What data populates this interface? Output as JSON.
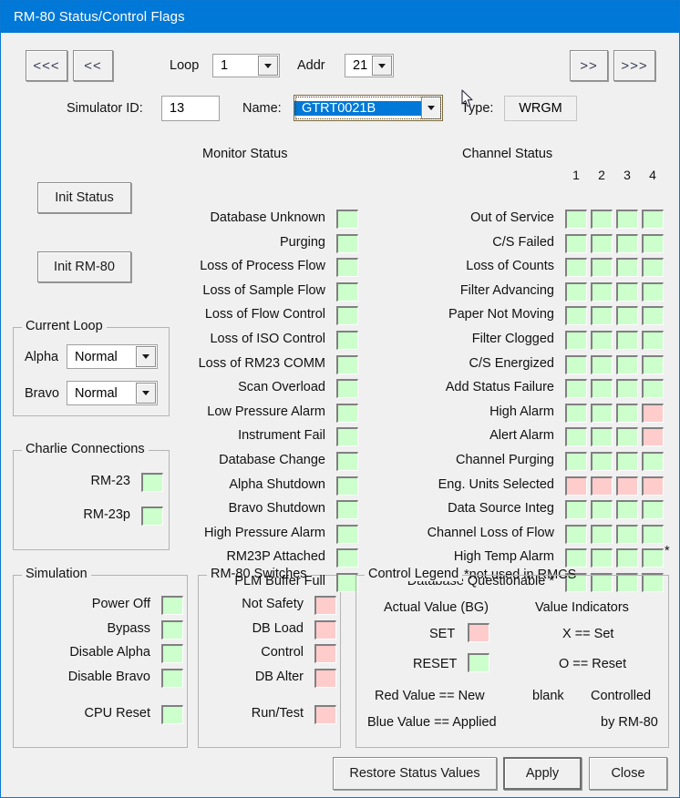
{
  "window": {
    "title": "RM-80 Status/Control Flags"
  },
  "toolbar": {
    "first_label": "<<<",
    "prev_label": "<<",
    "next_label": ">>",
    "last_label": ">>>",
    "loop_label": "Loop",
    "loop_value": "1",
    "addr_label": "Addr",
    "addr_value": "21"
  },
  "identity": {
    "simulator_id_label": "Simulator ID:",
    "simulator_id_value": "13",
    "name_label": "Name:",
    "name_value": "GTRT0021B",
    "type_label": "Type:",
    "type_value": "WRGM"
  },
  "left_buttons": {
    "init_status": "Init Status",
    "init_rm80": "Init RM-80"
  },
  "current_loop": {
    "title": "Current Loop",
    "alpha_label": "Alpha",
    "alpha_value": "Normal",
    "bravo_label": "Bravo",
    "bravo_value": "Normal"
  },
  "charlie_connections": {
    "title": "Charlie Connections",
    "items": [
      {
        "label": "RM-23",
        "state": "green"
      },
      {
        "label": "RM-23p",
        "state": "green"
      }
    ]
  },
  "simulation": {
    "title": "Simulation",
    "items": [
      {
        "label": "Power Off",
        "state": "green"
      },
      {
        "label": "Bypass",
        "state": "green"
      },
      {
        "label": "Disable Alpha",
        "state": "green"
      },
      {
        "label": "Disable Bravo",
        "state": "green"
      },
      {
        "label": "CPU Reset",
        "state": "green"
      }
    ]
  },
  "rm80_switches": {
    "title": "RM-80 Switches",
    "items": [
      {
        "label": "Not Safety",
        "state": "red"
      },
      {
        "label": "DB Load",
        "state": "red"
      },
      {
        "label": "Control",
        "state": "red"
      },
      {
        "label": "DB Alter",
        "state": "red"
      },
      {
        "label": "Run/Test",
        "state": "red"
      }
    ]
  },
  "monitor_status": {
    "title": "Monitor Status",
    "items": [
      {
        "label": "Database Unknown",
        "state": "green"
      },
      {
        "label": "Purging",
        "state": "green"
      },
      {
        "label": "Loss of Process Flow",
        "state": "green"
      },
      {
        "label": "Loss of Sample Flow",
        "state": "green"
      },
      {
        "label": "Loss of Flow Control",
        "state": "green"
      },
      {
        "label": "Loss of ISO Control",
        "state": "green"
      },
      {
        "label": "Loss of RM23 COMM",
        "state": "green"
      },
      {
        "label": "Scan Overload",
        "state": "green"
      },
      {
        "label": "Low Pressure Alarm",
        "state": "green"
      },
      {
        "label": "Instrument Fail",
        "state": "green"
      },
      {
        "label": "Database Change",
        "state": "green"
      },
      {
        "label": "Alpha Shutdown",
        "state": "green"
      },
      {
        "label": "Bravo Shutdown",
        "state": "green"
      },
      {
        "label": "High Pressure Alarm",
        "state": "green"
      },
      {
        "label": "RM23P Attached",
        "state": "green"
      },
      {
        "label": "PLM Buffer Full",
        "state": "green"
      }
    ]
  },
  "channel_status": {
    "title": "Channel Status",
    "channels": [
      "1",
      "2",
      "3",
      "4"
    ],
    "footnote": "*not used in RMCS",
    "trailing_asterisk": "*",
    "rows": [
      {
        "label": "Out of Service",
        "states": [
          "green",
          "green",
          "green",
          "green"
        ]
      },
      {
        "label": "C/S Failed",
        "states": [
          "green",
          "green",
          "green",
          "green"
        ]
      },
      {
        "label": "Loss of Counts",
        "states": [
          "green",
          "green",
          "green",
          "green"
        ]
      },
      {
        "label": "Filter Advancing",
        "states": [
          "green",
          "green",
          "green",
          "green"
        ]
      },
      {
        "label": "Paper Not Moving",
        "states": [
          "green",
          "green",
          "green",
          "green"
        ]
      },
      {
        "label": "Filter Clogged",
        "states": [
          "green",
          "green",
          "green",
          "green"
        ]
      },
      {
        "label": "C/S Energized",
        "states": [
          "green",
          "green",
          "green",
          "green"
        ]
      },
      {
        "label": "Add Status Failure",
        "states": [
          "green",
          "green",
          "green",
          "green"
        ]
      },
      {
        "label": "High Alarm",
        "states": [
          "green",
          "green",
          "green",
          "red"
        ]
      },
      {
        "label": "Alert Alarm",
        "states": [
          "green",
          "green",
          "green",
          "red"
        ]
      },
      {
        "label": "Channel Purging",
        "states": [
          "green",
          "green",
          "green",
          "green"
        ]
      },
      {
        "label": "Eng. Units Selected",
        "states": [
          "red",
          "red",
          "red",
          "red"
        ]
      },
      {
        "label": "Data Source Integ",
        "states": [
          "green",
          "green",
          "green",
          "green"
        ]
      },
      {
        "label": "Channel Loss of Flow",
        "states": [
          "green",
          "green",
          "green",
          "green"
        ]
      },
      {
        "label": "High Temp Alarm",
        "states": [
          "green",
          "green",
          "green",
          "green"
        ]
      },
      {
        "label": "* Database Questionable *",
        "states": [
          "green",
          "green",
          "green",
          "green"
        ]
      }
    ]
  },
  "control_legend": {
    "title": "Control Legend",
    "actual_value_header": "Actual Value (BG)",
    "value_indicators_header": "Value Indicators",
    "set_label": "SET",
    "set_state": "red",
    "reset_label": "RESET",
    "reset_state": "green",
    "x_set": "X == Set",
    "o_reset": "O == Reset",
    "red_new": "Red Value == New",
    "blue_applied": "Blue Value == Applied",
    "blank": "blank",
    "controlled_1": "Controlled",
    "controlled_2": "by RM-80"
  },
  "footer": {
    "restore_label": "Restore Status Values",
    "apply_label": "Apply",
    "close_label": "Close"
  },
  "colors": {
    "titlebar": "#0078d7",
    "face": "#f0f0f0",
    "green": "#ccffcc",
    "red": "#ffcccc",
    "selection": "#0078d7"
  }
}
